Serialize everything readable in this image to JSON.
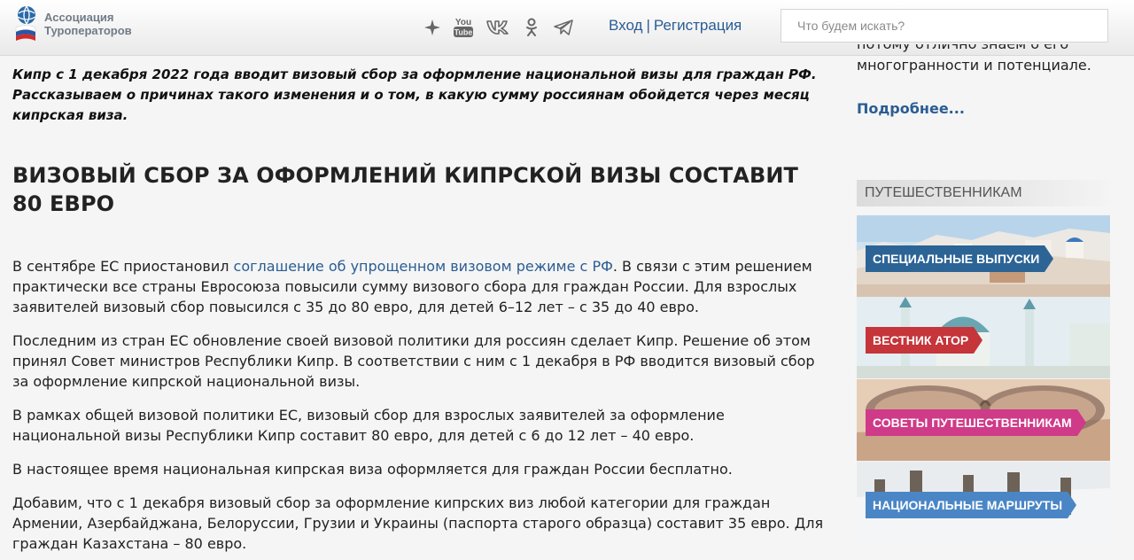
{
  "header": {
    "logo": {
      "line1": "Ассоциация",
      "line2": "Туроператоров"
    },
    "social": [
      "sparkle-icon",
      "youtube-icon",
      "vk-icon",
      "odnoklassniki-icon",
      "telegram-icon"
    ],
    "youtube_text": {
      "top": "You",
      "bottom": "Tube"
    },
    "auth": {
      "login": "Вход",
      "separator": "|",
      "register": "Регистрация"
    },
    "search": {
      "placeholder": "Что будем искать?",
      "value": ""
    }
  },
  "article": {
    "lead": "Кипр с 1 декабря 2022 года вводит визовый сбор за оформление национальной визы для граждан РФ. Рассказываем о причинах такого изменения и о том, в какую сумму россиянам обойдется через месяц кипрская виза.",
    "heading": "ВИЗОВЫЙ СБОР ЗА ОФОРМЛЕНИЙ КИПРСКОЙ ВИЗЫ СОСТАВИТ 80 ЕВРО",
    "p1_before": "В сентябре ЕС приостановил ",
    "p1_link": "соглашение об упрощенном визовом режиме с РФ",
    "p1_after": ". В связи с этим решением практически все страны Евросоюза повысили сумму визового сбора для граждан России. Для взрослых заявителей визовый сбор повысился с 35 до 80 евро, для детей 6–12 лет – с 35 до 40 евро.",
    "p2": "Последним из стран ЕС обновление своей визовой политики для россиян сделает Кипр. Решение об этом принял Совет министров Республики Кипр. В соответствии с ним с 1 декабря в РФ вводится визовый сбор за оформление кипрской национальной визы.",
    "p3": "В рамках общей визовой политики ЕС, визовый сбор для взрослых заявителей за оформление национальной визы Республики Кипр составит 80 евро, для детей с 6 до 12 лет – 40 евро.",
    "p4": "В настоящее время национальная кипрская виза оформляется для граждан России бесплатно.",
    "p5": "Добавим, что с 1 декабря визовый сбор за оформление кипрских виз любой категории для граждан Армении, Азербайджана, Белоруссии, Грузии и Украины (паспорта старого образца) составит 35 евро. Для граждан Казахстана – 80 евро."
  },
  "sidebar": {
    "text_cut": "потому отлично знаем о его",
    "text_line2": "многогранности и потенциале.",
    "more": "Подробнее...",
    "section_title": "Путешественникам",
    "cards": [
      {
        "label": "Специальные выпуски",
        "color": "#2c6496"
      },
      {
        "label": "Вестник АТОР",
        "color": "#c5353a"
      },
      {
        "label": "Советы путешественникам",
        "color": "#cf3b88"
      },
      {
        "label": "Национальные маршруты",
        "color": "#4a86c5"
      }
    ]
  }
}
